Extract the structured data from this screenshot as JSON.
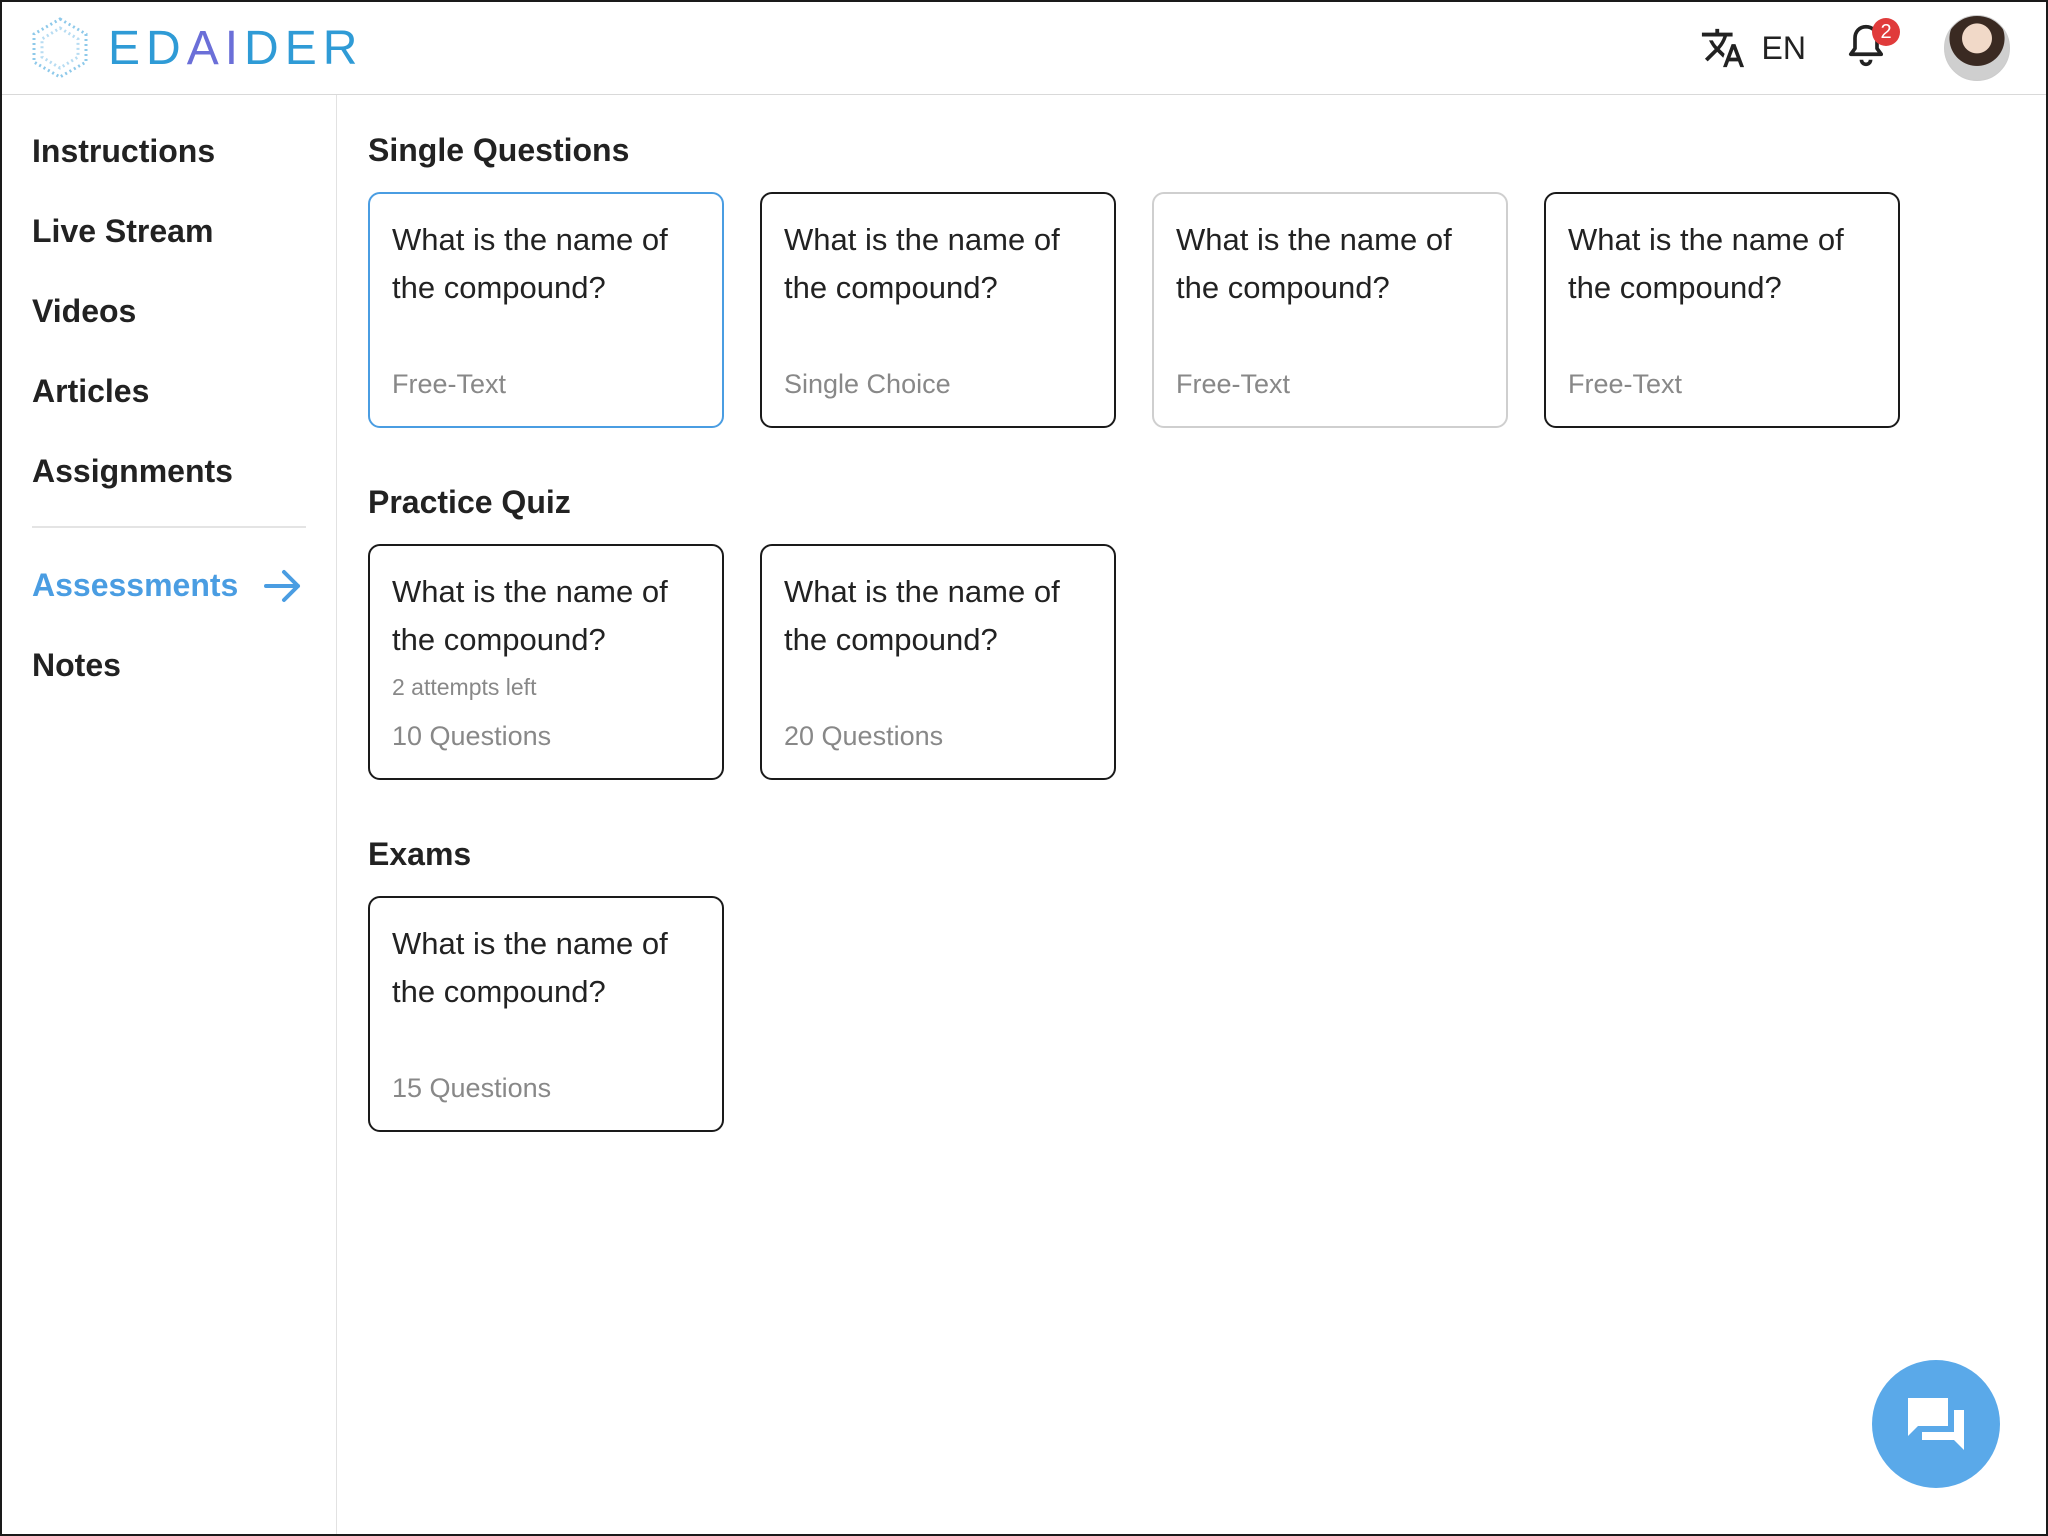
{
  "header": {
    "brand": {
      "prefix": "ED",
      "highlight": "AI",
      "suffix": "DER"
    },
    "language": "EN",
    "notification_count": "2",
    "icons": {
      "translate": "translate-icon",
      "bell": "bell-icon",
      "avatar": "user-avatar"
    }
  },
  "sidebar": {
    "items": [
      {
        "label": "Instructions"
      },
      {
        "label": "Live Stream"
      },
      {
        "label": "Videos"
      },
      {
        "label": "Articles"
      },
      {
        "label": "Assignments"
      }
    ],
    "active": {
      "label": "Assessments",
      "icon": "arrow-right-icon"
    },
    "after": [
      {
        "label": "Notes"
      }
    ]
  },
  "sections": {
    "single": {
      "title": "Single Questions",
      "cards": [
        {
          "question": "What is the name of the compound?",
          "type": "Free-Text"
        },
        {
          "question": "What is the name of the compound?",
          "type": "Single Choice"
        },
        {
          "question": "What is the name of the compound?",
          "type": "Free-Text"
        },
        {
          "question": "What is the name of the compound?",
          "type": "Free-Text"
        }
      ]
    },
    "practice": {
      "title": "Practice Quiz",
      "cards": [
        {
          "question": "What is the name of the compound?",
          "attempts": "2 attempts left",
          "count": "10 Questions"
        },
        {
          "question": "What is the name of the compound?",
          "count": "20 Questions"
        }
      ]
    },
    "exams": {
      "title": "Exams",
      "cards": [
        {
          "question": "What is the name of the compound?",
          "count": "15 Questions"
        }
      ]
    }
  },
  "colors": {
    "accent": "#4a9de2",
    "fab": "#5aa9e9",
    "badge": "#e03b3b",
    "brand": "#2f9bd6",
    "brand_ai": "#6b6fd8"
  },
  "fab": {
    "icon": "chat-icon"
  }
}
